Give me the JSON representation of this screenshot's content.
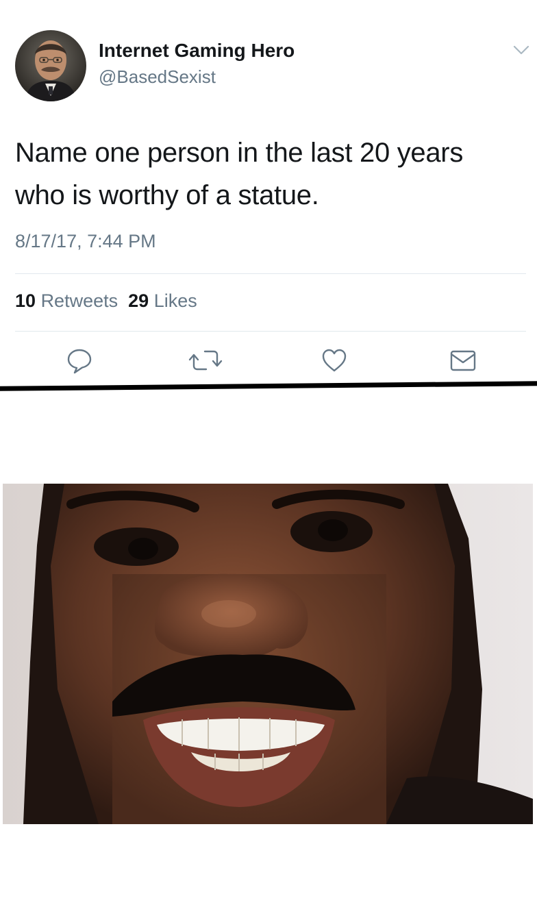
{
  "tweet": {
    "author": {
      "display_name": "Internet Gaming Hero",
      "handle": "@BasedSexist"
    },
    "text_line1": "Name one person in the last 20 years",
    "text_line2": "who is worthy of a statue.",
    "timestamp": "8/17/17, 7:44 PM",
    "stats": {
      "retweets_count": "10",
      "retweets_label": "Retweets",
      "likes_count": "29",
      "likes_label": "Likes"
    },
    "actions": [
      "reply-icon",
      "retweet-icon",
      "like-icon",
      "message-icon"
    ]
  },
  "colors": {
    "primary_text": "#14171a",
    "secondary_text": "#657786",
    "divider": "#e1e8ed",
    "separator": "#000000"
  }
}
